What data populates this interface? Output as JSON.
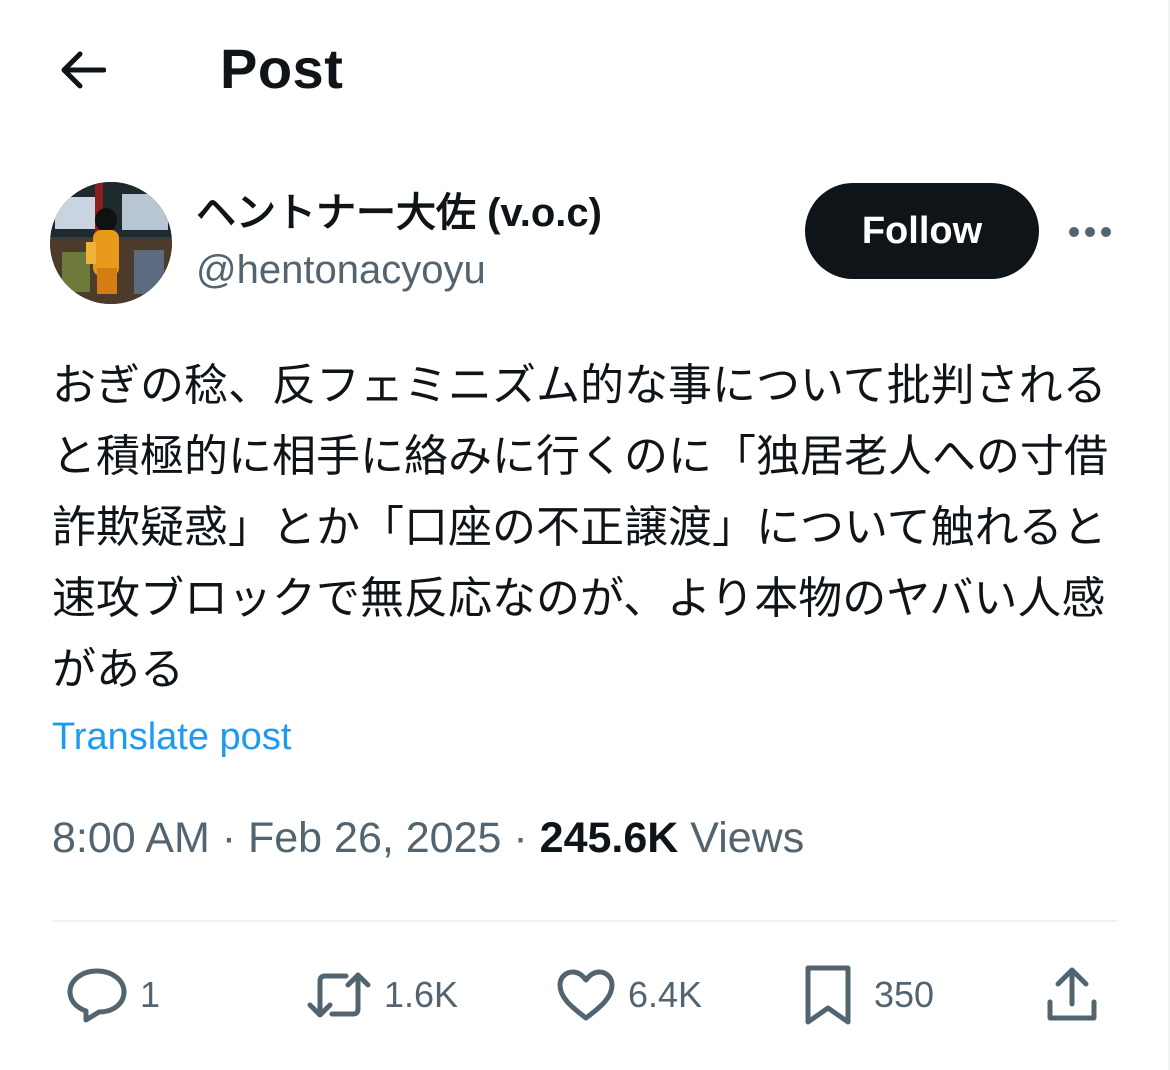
{
  "header": {
    "title": "Post",
    "back_icon": "arrow-left-icon"
  },
  "author": {
    "display_name": "ヘントナー大佐 (v.o.c)",
    "handle": "@hentonacyoyu",
    "follow_label": "Follow",
    "more_icon": "more-horizontal-icon"
  },
  "post": {
    "text": "おぎの稔、反フェミニズム的な事について批判されると積極的に相手に絡みに行くのに「独居老人への寸借詐欺疑惑」とか「口座の不正譲渡」について触れると速攻ブロックで無反応なのが、より本物のヤバい人感がある",
    "translate_label": "Translate post"
  },
  "meta": {
    "time": "8:00 AM",
    "separator": "·",
    "date": "Feb 26, 2025",
    "views_count": "245.6K",
    "views_label": "Views"
  },
  "actions": {
    "replies": "1",
    "reposts": "1.6K",
    "likes": "6.4K",
    "bookmarks": "350"
  },
  "colors": {
    "text": "#0f1419",
    "secondary": "#536471",
    "link": "#1d9bf0",
    "follow_bg": "#0f1419",
    "divider": "#eff3f4"
  }
}
